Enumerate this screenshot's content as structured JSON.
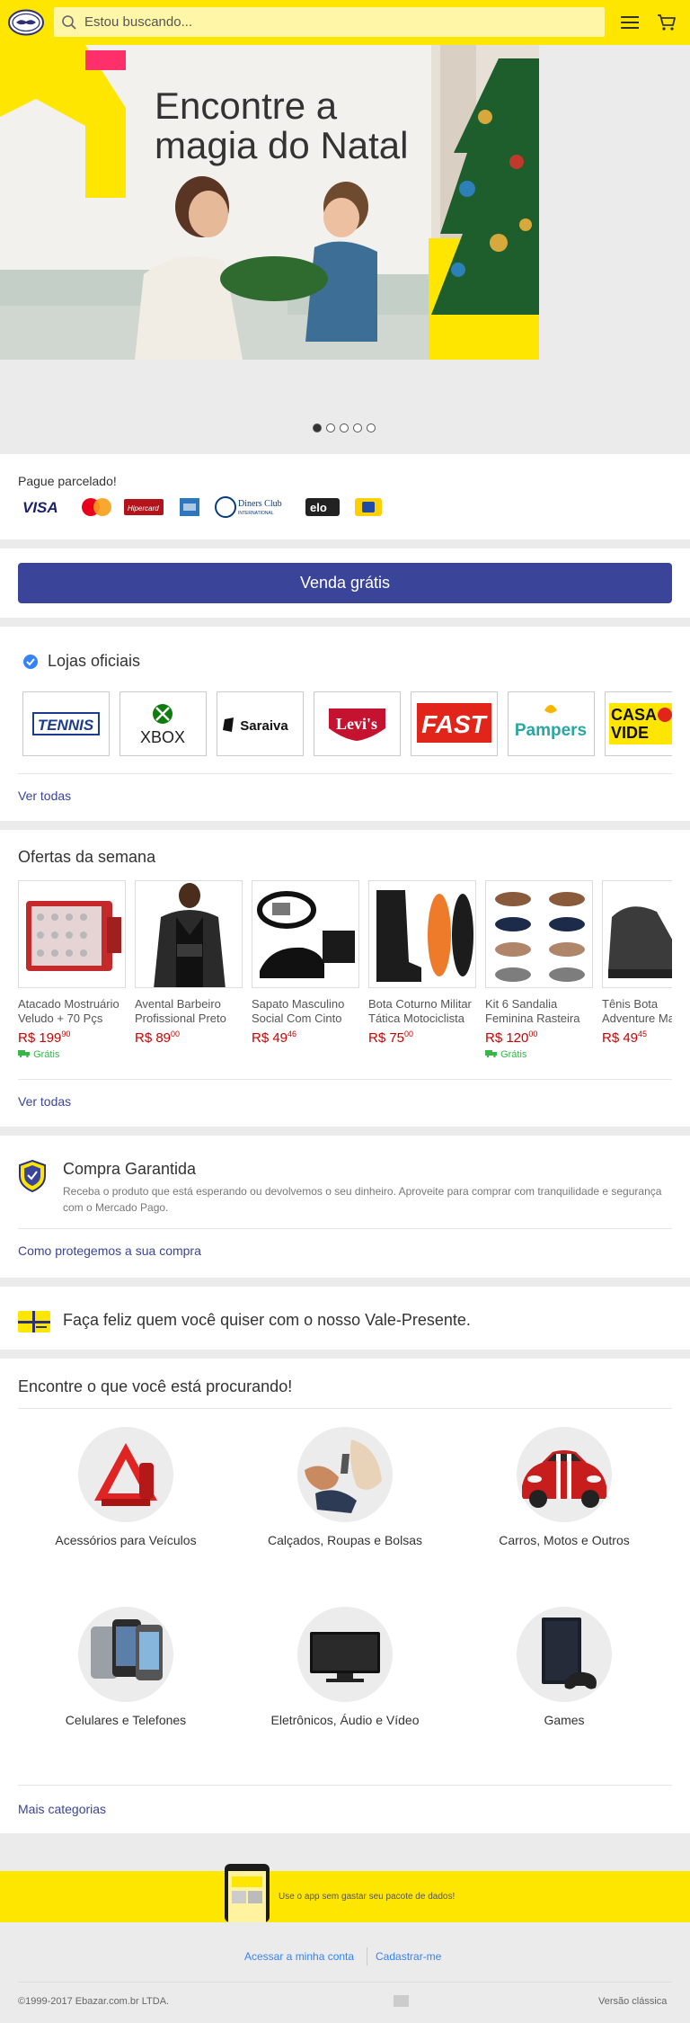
{
  "header": {
    "search_placeholder": "Estou buscando..."
  },
  "hero": {
    "line1": "Encontre a",
    "line2": "magia do Natal",
    "dots": 5,
    "active_dot": 0
  },
  "payment": {
    "label": "Pague parcelado!",
    "cards": [
      "Visa",
      "Mastercard",
      "Hipercard",
      "American Express",
      "Diners Club",
      "Elo",
      "Naranja"
    ]
  },
  "sell": {
    "button_label": "Venda grátis"
  },
  "stores": {
    "title": "Lojas oficiais",
    "items": [
      "World Tennis",
      "Xbox",
      "Saraiva",
      "Levi's",
      "Fast Shop",
      "Pampers",
      "Casa & Vídeo"
    ],
    "see_all": "Ver todas"
  },
  "offers": {
    "title": "Ofertas da semana",
    "items": [
      {
        "title": "Atacado Mostruário Veludo + 70 Pçs",
        "price_int": "R$ 199",
        "price_dec": "90",
        "free": "Grátis"
      },
      {
        "title": "Avental Barbeiro Profissional Preto",
        "price_int": "R$ 89",
        "price_dec": "00",
        "free": ""
      },
      {
        "title": "Sapato Masculino Social Com Cinto",
        "price_int": "R$ 49",
        "price_dec": "46",
        "free": ""
      },
      {
        "title": "Bota Coturno Militar Tática Motociclista",
        "price_int": "R$ 75",
        "price_dec": "00",
        "free": ""
      },
      {
        "title": "Kit 6 Sandalia Feminina Rasteira",
        "price_int": "R$ 120",
        "price_dec": "00",
        "free": "Grátis"
      },
      {
        "title": "Tênis Bota Adventure Ma",
        "price_int": "R$ 49",
        "price_dec": "45",
        "free": ""
      }
    ],
    "see_all": "Ver todas"
  },
  "guarantee": {
    "title": "Compra Garantida",
    "text": "Receba o produto que está esperando ou devolvemos o seu dinheiro. Aproveite para comprar com tranquilidade e segurança com o Mercado Pago.",
    "link": "Como protegemos a sua compra"
  },
  "gift": {
    "text": "Faça feliz quem você quiser com o nosso Vale-Presente."
  },
  "categories": {
    "title": "Encontre o que você está procurando!",
    "items": [
      "Acessórios para Veículos",
      "Calçados, Roupas e Bolsas",
      "Carros, Motos e Outros",
      "Celulares e Telefones",
      "Eletrônicos, Áudio e Vídeo",
      "Games"
    ],
    "more": "Mais categorias"
  },
  "app_banner": {
    "text": "Use o app sem gastar seu pacote de dados!"
  },
  "footer": {
    "login": "Acessar a minha conta",
    "signup": "Cadastrar-me",
    "copyright": "©1999-2017 Ebazar.com.br LTDA.",
    "classic": "Versão clássica"
  },
  "colors": {
    "brand_yellow": "#ffe600",
    "brand_blue": "#3a4499",
    "price_red": "#cc0000",
    "free_green": "#39b54a"
  }
}
